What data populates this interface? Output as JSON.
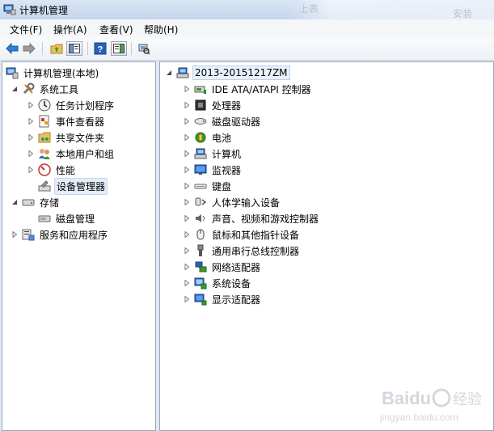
{
  "window": {
    "title": "计算机管理"
  },
  "menu": [
    "文件(F)",
    "操作(A)",
    "查看(V)",
    "帮助(H)"
  ],
  "background_ghost": {
    "left_text": "上表",
    "right_text": "安装"
  },
  "toolbar": {
    "buttons": [
      "back-icon",
      "forward-icon",
      "up-folder-icon",
      "show-hide-console-tree-icon",
      "help-icon",
      "show-hide-action-pane-icon",
      "scan-hardware-icon"
    ]
  },
  "left_tree": {
    "root": "计算机管理(本地)",
    "system_tools": "系统工具",
    "task_scheduler": "任务计划程序",
    "event_viewer": "事件查看器",
    "shared_folders": "共享文件夹",
    "local_users": "本地用户和组",
    "performance": "性能",
    "device_manager": "设备管理器",
    "storage": "存储",
    "disk_management": "磁盘管理",
    "services_apps": "服务和应用程序"
  },
  "device_tree": {
    "computer_name": "2013-20151217ZM",
    "categories": [
      {
        "label": "IDE ATA/ATAPI 控制器",
        "icon": "ide-controller-icon"
      },
      {
        "label": "处理器",
        "icon": "processor-icon"
      },
      {
        "label": "磁盘驱动器",
        "icon": "disk-drive-icon"
      },
      {
        "label": "电池",
        "icon": "battery-icon"
      },
      {
        "label": "计算机",
        "icon": "computer-icon"
      },
      {
        "label": "监视器",
        "icon": "monitor-icon"
      },
      {
        "label": "键盘",
        "icon": "keyboard-icon"
      },
      {
        "label": "人体学输入设备",
        "icon": "hid-icon"
      },
      {
        "label": "声音、视频和游戏控制器",
        "icon": "sound-icon"
      },
      {
        "label": "鼠标和其他指针设备",
        "icon": "mouse-icon"
      },
      {
        "label": "通用串行总线控制器",
        "icon": "usb-icon"
      },
      {
        "label": "网络适配器",
        "icon": "network-adapter-icon"
      },
      {
        "label": "系统设备",
        "icon": "system-device-icon"
      },
      {
        "label": "显示适配器",
        "icon": "display-adapter-icon"
      }
    ]
  },
  "watermark": {
    "brand": "Baidu",
    "brand_cn": "经验",
    "url": "jingyan.baidu.com"
  },
  "colors": {
    "window_frame": "#dfe8f4",
    "pane_border": "#9aa7b8",
    "selection": "#e5eef8",
    "arrow": "#5a5a5a"
  }
}
